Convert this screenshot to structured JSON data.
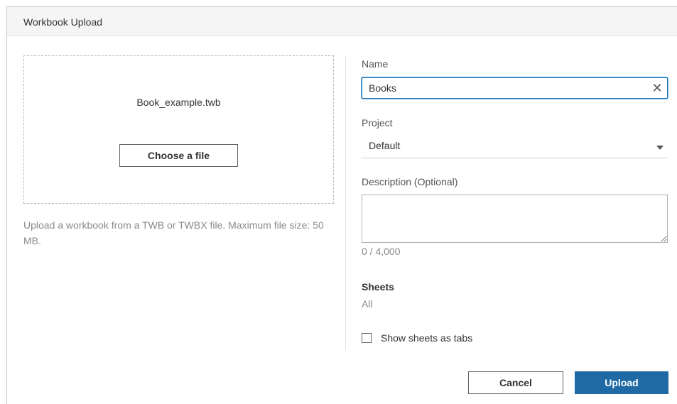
{
  "dialog": {
    "title": "Workbook Upload"
  },
  "upload": {
    "file_name": "Book_example.twb",
    "choose_label": "Choose a file",
    "help_text": "Upload a workbook from a TWB or TWBX file. Maximum file size: 50 MB."
  },
  "form": {
    "name_label": "Name",
    "name_value": "Books",
    "project_label": "Project",
    "project_value": "Default",
    "description_label": "Description (Optional)",
    "description_value": "",
    "char_count": "0 / 4,000",
    "sheets_title": "Sheets",
    "sheets_value": "All",
    "tabs_checkbox_label": "Show sheets as tabs",
    "tabs_checked": false
  },
  "footer": {
    "cancel_label": "Cancel",
    "upload_label": "Upload"
  },
  "icons": {
    "clear": "close-icon",
    "dropdown": "caret-down-icon"
  },
  "colors": {
    "primary": "#1f6aa5",
    "focus": "#1f77b4"
  }
}
